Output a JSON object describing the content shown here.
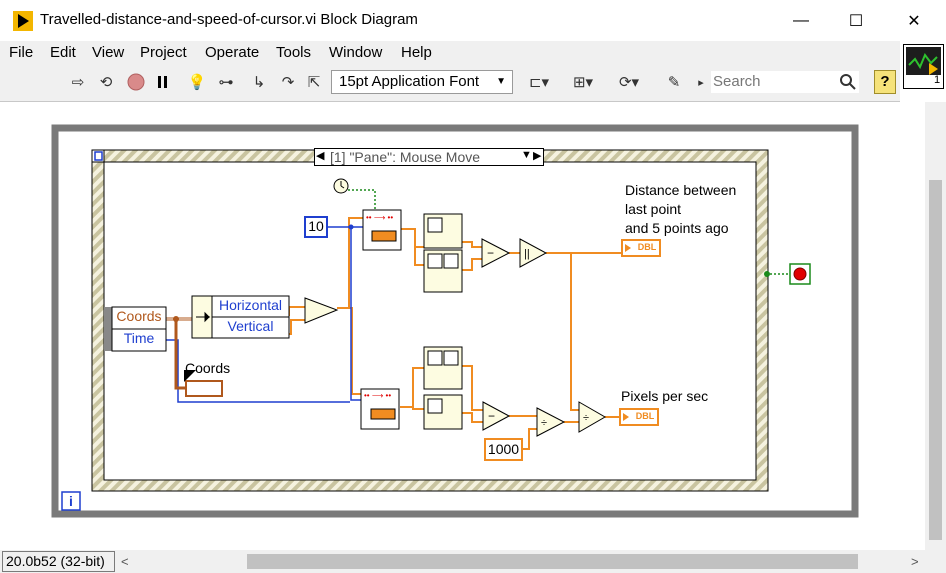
{
  "window": {
    "title": "Travelled-distance-and-speed-of-cursor.vi Block Diagram",
    "minimize": "—",
    "maximize": "☐",
    "close": "✕"
  },
  "menu": [
    "File",
    "Edit",
    "View",
    "Project",
    "Operate",
    "Tools",
    "Window",
    "Help"
  ],
  "toolbar": {
    "font": "15pt Application Font",
    "search_placeholder": "Search",
    "help": "?"
  },
  "vi_icon": {
    "number": "1"
  },
  "diagram": {
    "case_selector": "[1] \"Pane\": Mouse Move",
    "event_data": [
      "Coords",
      "Time"
    ],
    "unbundle": [
      "Horizontal",
      "Vertical"
    ],
    "history_size": "10",
    "coords_label": "Coords",
    "distance_label": [
      "Distance between",
      "last point",
      "and 5 points ago"
    ],
    "speed_label": "Pixels per sec",
    "indicator_dbl": "DBL",
    "ms_constant": "1000",
    "loop_info": "i"
  },
  "status": {
    "version": "20.0b52 (32-bit)"
  },
  "colors": {
    "wire_orange": "#f08c21",
    "wire_blue": "#1f3fcf",
    "loop_gray": "#888888",
    "stop_red": "#e00000"
  }
}
